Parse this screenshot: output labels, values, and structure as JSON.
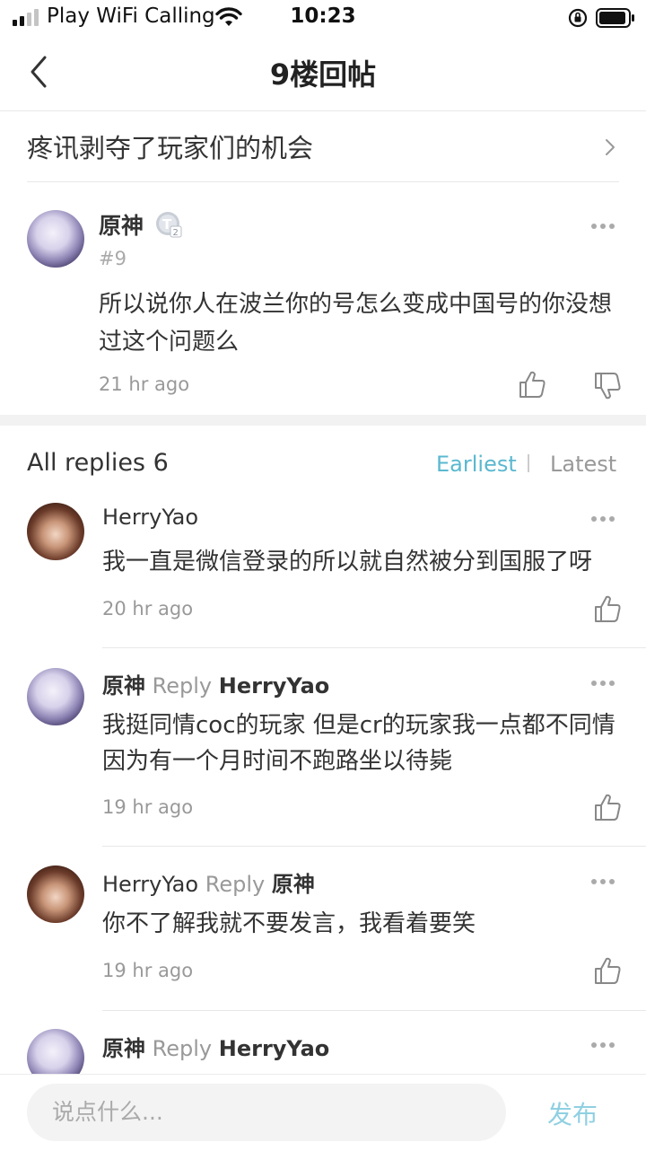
{
  "status_bar": {
    "carrier": "Play WiFi Calling",
    "time": "10:23"
  },
  "nav": {
    "title": "9楼回帖"
  },
  "thread": {
    "title": "疼讯剥夺了玩家们的机会"
  },
  "post": {
    "author": "原神",
    "floor": "#9",
    "text": "所以说你人在波兰你的号怎么变成中国号的你没想过这个问题么",
    "time": "21 hr ago"
  },
  "replies_header": {
    "label": "All replies",
    "count": "6",
    "sort_earliest": "Earliest",
    "sort_latest": "Latest"
  },
  "replies": [
    {
      "author": "HerryYao",
      "text": "我一直是微信登录的所以就自然被分到国服了呀",
      "time": "20 hr ago"
    },
    {
      "author": "原神",
      "reply_word": "Reply",
      "reply_to": "HerryYao",
      "text": "我挺同情coc的玩家 但是cr的玩家我一点都不同情 因为有一个月时间不跑路坐以待毙",
      "time": "19 hr ago"
    },
    {
      "author": "HerryYao",
      "reply_word": "Reply",
      "reply_to": "原神",
      "text": "你不了解我就不要发言，我看着要笑",
      "time": "19 hr ago"
    },
    {
      "author": "原神",
      "reply_word": "Reply",
      "reply_to": "HerryYao"
    }
  ],
  "composer": {
    "placeholder": "说点什么...",
    "send_label": "发布"
  },
  "colors": {
    "accent": "#5bb8d0",
    "send_disabled": "#8fd0e2"
  },
  "icons": [
    "signal-icon",
    "wifi-icon",
    "orientation-lock-icon",
    "battery-icon",
    "back-arrow-icon",
    "chevron-right-icon",
    "level-badge-icon",
    "more-icon",
    "thumbs-up-icon",
    "thumbs-down-icon"
  ]
}
